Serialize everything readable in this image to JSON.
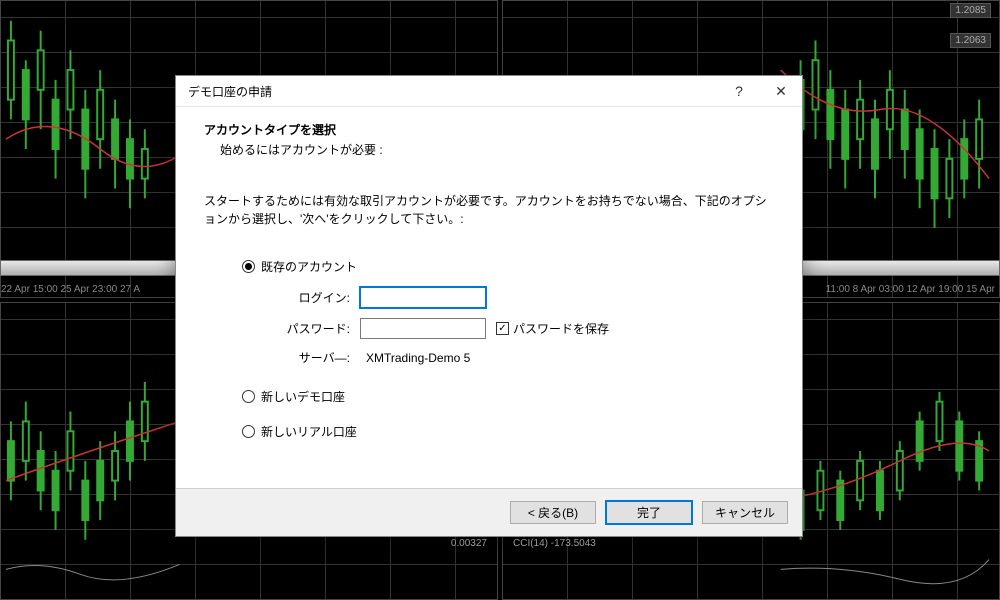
{
  "background": {
    "price_labels": [
      "1.2085",
      "1.2063"
    ],
    "time_labels_left": "22 Apr 15:00   25 Apr 23:00   27 A",
    "time_labels_right": "11:00   8 Apr 03:00   12 Apr 19:00   15 Apr",
    "indicator_bottom_left": "0.00327",
    "indicator_bottom_right": "CCI(14) -173.5043"
  },
  "dialog": {
    "title": "デモ口座の申請",
    "heading": "アカウントタイプを選択",
    "subheading": "始めるにはアカウントが必要 :",
    "instruction": "スタートするためには有効な取引アカウントが必要です。アカウントをお持ちでない場合、下記のオプションから選択し、'次へ'をクリックして下さい。:",
    "options": {
      "existing": "既存のアカウント",
      "new_demo": "新しいデモ口座",
      "new_real": "新しいリアル口座"
    },
    "form": {
      "login_label": "ログイン:",
      "login_value": "",
      "password_label": "パスワード:",
      "password_value": "",
      "save_password_label": "パスワードを保存",
      "server_label": "サーバ―:",
      "server_value": "XMTrading-Demo 5"
    },
    "buttons": {
      "back": "< 戻る(B)",
      "finish": "完了",
      "cancel": "キャンセル"
    }
  }
}
